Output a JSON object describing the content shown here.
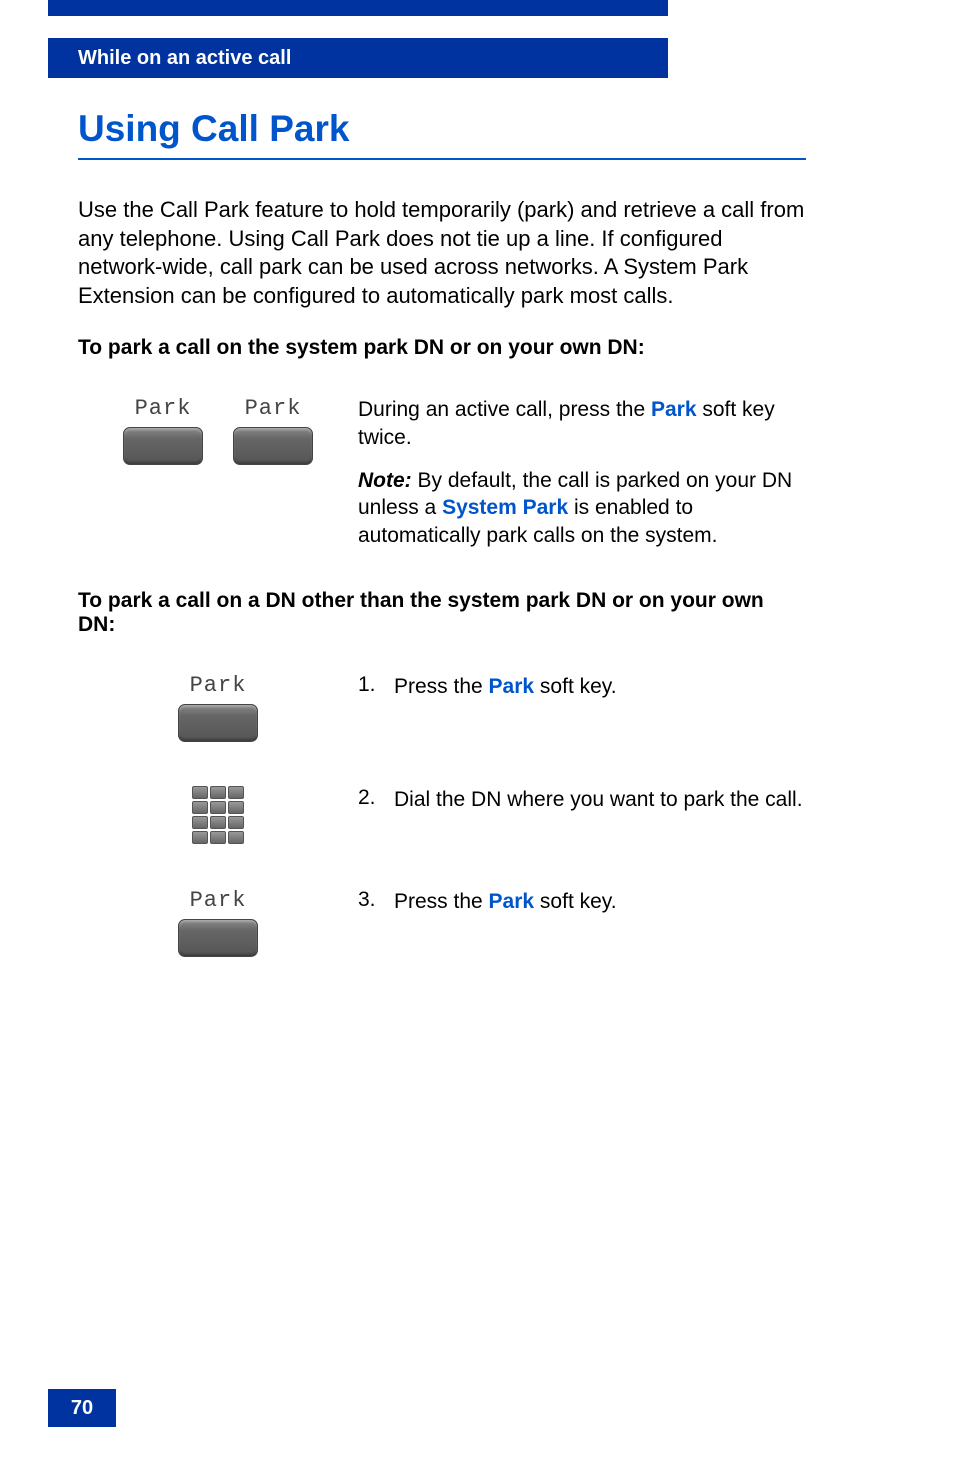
{
  "header": {
    "section": "While on an active call"
  },
  "title": "Using Call Park",
  "intro": "Use the Call Park feature to hold temporarily (park) and retrieve a call from any telephone. Using Call Park does not tie up a line. If configured network-wide, call park can be used across networks. A System Park Extension can be configured to automatically park most calls.",
  "subheading1": "To park a call on the system park DN or on your own DN:",
  "softkey_label": "Park",
  "step1": {
    "text_prefix": "During an active call, press the ",
    "park": "Park",
    "text_suffix": " soft key twice.",
    "note_label": "Note:",
    "note_prefix": " By default, the call is parked on your DN unless a ",
    "system_park": "System Park",
    "note_suffix": " is enabled to automatically park calls on the system."
  },
  "subheading2": "To park a call on a DN other than the system park DN or on your own DN:",
  "steps": [
    {
      "num": "1.",
      "prefix": "Press the ",
      "bold": "Park",
      "suffix": " soft key."
    },
    {
      "num": "2.",
      "prefix": "Dial the DN where you want to park the call.",
      "bold": "",
      "suffix": ""
    },
    {
      "num": "3.",
      "prefix": "Press the ",
      "bold": "Park",
      "suffix": " soft key."
    }
  ],
  "page_number": "70"
}
